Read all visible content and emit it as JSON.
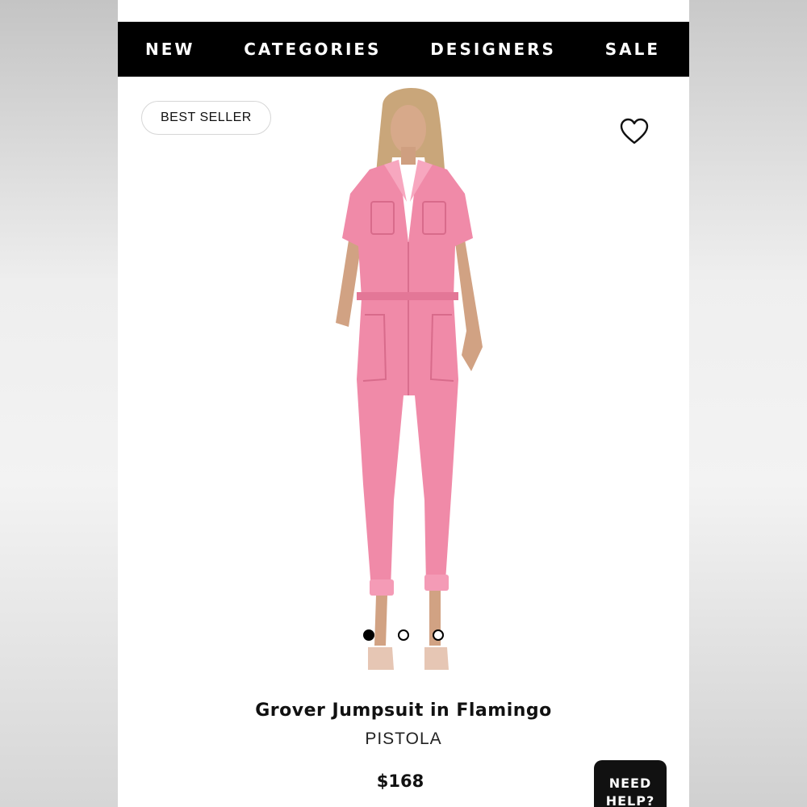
{
  "nav": {
    "items": [
      "NEW",
      "CATEGORIES",
      "DESIGNERS",
      "SALE"
    ]
  },
  "product": {
    "badge": "BEST SELLER",
    "name": "Grover Jumpsuit in Flamingo",
    "brand": "PISTOLA",
    "price": "$168",
    "image_icon": "product-photo-jumpsuit",
    "color": "#f08aa8"
  },
  "carousel": {
    "count": 3,
    "active_index": 0
  },
  "help": {
    "line1": "NEED",
    "line2": "HELP?"
  },
  "colors": {
    "nav_bg": "#000000",
    "nav_text": "#ffffff",
    "accent": "#111111"
  }
}
